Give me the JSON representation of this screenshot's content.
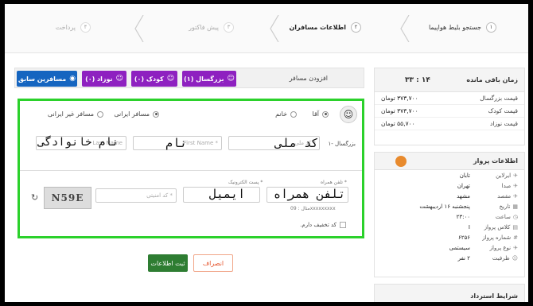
{
  "stepper": {
    "steps": [
      {
        "num": "۱",
        "label": "جستجو بلیط هواپیما"
      },
      {
        "num": "۲",
        "label": "اطلاعات مسافران"
      },
      {
        "num": "۳",
        "label": "پیش فاکتور"
      },
      {
        "num": "۴",
        "label": "پرداخت"
      }
    ]
  },
  "toolbar": {
    "title": "افزودن مسافر",
    "adult_label": "بزرگسال (۱)",
    "child_label": "کودک (۰)",
    "infant_label": "نوزاد (۰)",
    "previous_label": "مسافرین سابق"
  },
  "passenger": {
    "row_label": "۱- بزرگسال",
    "gender_male": "آقا",
    "gender_female": "خانم",
    "iranian": "مسافر ایرانی",
    "non_iranian": "مسافر غیر ایرانی",
    "national_code_ph": "کد ملی *",
    "national_code_val": "کد ملی",
    "first_name_ph": "First Name *",
    "first_name_val": "نام",
    "last_name_ph": "Last Name",
    "last_name_val": "نام خانوادگی"
  },
  "contact": {
    "mobile_label": "تلفن همراه *",
    "mobile_val": "تلفن همراه",
    "mobile_hint": "مثال : 09xxxxxxxxx",
    "email_label": "پست الکترونیک *",
    "email_val": "ایمیل",
    "security_ph": "کد امنیتی *",
    "captcha_text": "N59E",
    "discount_label": "کد تخفیف دارم."
  },
  "actions": {
    "save": "ثبت اطلاعات",
    "cancel": "انصراف"
  },
  "sidebar": {
    "timer_label": "زمان باقی مانده",
    "timer_value": "۱۴ : ۳۳",
    "prices": [
      {
        "label": "قیمت بزرگسال",
        "value": "۳۷۳,۷۰۰ تومان"
      },
      {
        "label": "قیمت کودک",
        "value": "۳۷۳,۷۰۰ تومان"
      },
      {
        "label": "قیمت نوزاد",
        "value": "۵۵,۷۰۰ تومان"
      }
    ],
    "flight_title": "اطلاعات پرواز",
    "flight_rows": [
      {
        "label": "ایرلاین",
        "value": "تابان"
      },
      {
        "label": "مبدا",
        "value": "تهران"
      },
      {
        "label": "مقصد",
        "value": "مشهد"
      },
      {
        "label": "تاریخ",
        "value": "پنجشنبه ۱۶ اردیبهشت"
      },
      {
        "label": "ساعت",
        "value": "۲۳:۰۰"
      },
      {
        "label": "کلاس پرواز",
        "value": "I"
      },
      {
        "label": "شماره پرواز",
        "value": "۶۲۵۶"
      },
      {
        "label": "نوع پرواز",
        "value": "سیستمی"
      },
      {
        "label": "ظرفیت",
        "value": "۲ نفر"
      }
    ],
    "refund_title": "شرایط استرداد"
  },
  "colors": {
    "accent_purple": "#8e21c0",
    "accent_blue": "#1565c0",
    "highlight_green": "#2bd12b",
    "save_green": "#2e7d32",
    "cancel_orange": "#e6542c"
  }
}
